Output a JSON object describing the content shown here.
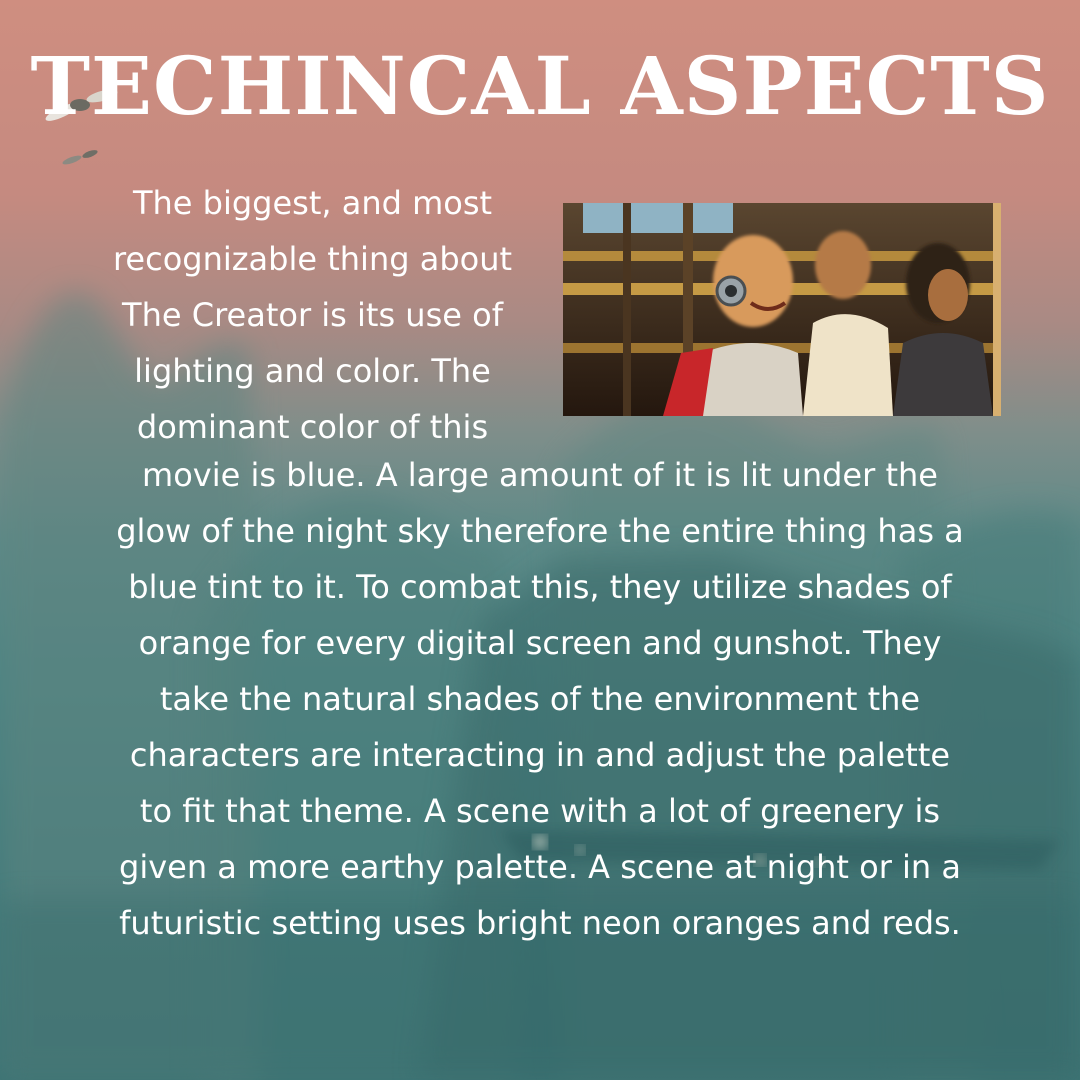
{
  "title": "TECHINCAL ASPECTS",
  "intro_lines": [
    "The biggest, and most",
    "recognizable thing about",
    "The Creator is its use of",
    "lighting and color. The",
    "dominant color of this"
  ],
  "body_lines": [
    "movie is blue. A large amount of it is lit under the",
    "glow of the night sky therefore the entire thing has a",
    "blue tint to it. To combat this, they utilize shades of",
    "orange for every digital screen and gunshot. They",
    "take the natural shades of the environment the",
    "characters are interacting in and adjust the palette",
    "to fit that theme. A scene with a lot of greenery is",
    "given a more earthy palette. A scene at night or in a",
    "futuristic setting uses bright neon oranges and reds."
  ],
  "colors": {
    "sky_top": "#cf8e80",
    "sky_bottom": "#3c7475",
    "text": "#ffffff"
  }
}
